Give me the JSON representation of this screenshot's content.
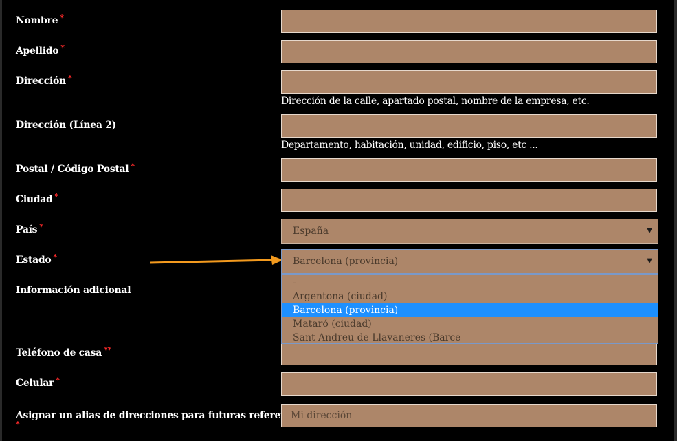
{
  "fields": {
    "nombre": {
      "label": "Nombre",
      "required": "*"
    },
    "apellido": {
      "label": "Apellido",
      "required": "*"
    },
    "direccion": {
      "label": "Dirección",
      "required": "*",
      "help": "Dirección de la calle, apartado postal, nombre de la empresa, etc."
    },
    "direccion2": {
      "label": "Dirección (Línea 2)",
      "help": "Departamento, habitación, unidad, edificio, piso, etc ..."
    },
    "postal": {
      "label": "Postal / Código Postal",
      "required": "*"
    },
    "ciudad": {
      "label": "Ciudad",
      "required": "*"
    },
    "pais": {
      "label": "País",
      "required": "*",
      "value": "España"
    },
    "estado": {
      "label": "Estado",
      "required": "*",
      "value": "Barcelona (provincia)"
    },
    "info": {
      "label": "Información adicional"
    },
    "telefono": {
      "label": "Teléfono de casa",
      "required": "**"
    },
    "celular": {
      "label": "Celular",
      "required": "*"
    },
    "alias": {
      "label": "Asignar un alias de direcciones para futuras referencias.",
      "required": "*",
      "placeholder": "Mi dirección"
    }
  },
  "estado_options": [
    {
      "label": "-",
      "selected": false
    },
    {
      "label": "Argentona (ciudad)",
      "selected": false
    },
    {
      "label": "Barcelona (provincia)",
      "selected": true
    },
    {
      "label": "Mataró (ciudad)",
      "selected": false
    },
    {
      "label": "Sant Andreu de Llavaneres (Barce",
      "selected": false
    }
  ],
  "colors": {
    "field_bg": "#ad8669",
    "page_bg": "#000000",
    "required": "#ff2a2a",
    "highlight": "#1e90ff",
    "annotation_arrow": "#f39a1e"
  },
  "icons": {
    "dropdown_caret": "chevron-down-icon",
    "annotation": "arrow-right-icon"
  }
}
